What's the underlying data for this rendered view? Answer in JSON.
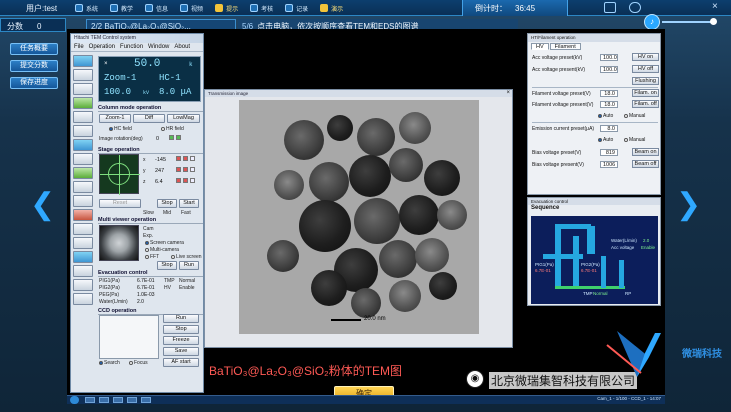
{
  "topbar": {
    "user": "用户:test",
    "nav": [
      {
        "label": "系统",
        "icon": "system-icon"
      },
      {
        "label": "教学",
        "icon": "teaching-icon"
      },
      {
        "label": "信息",
        "icon": "info-icon"
      },
      {
        "label": "视频",
        "icon": "video-icon"
      },
      {
        "label": "提示",
        "icon": "hint-icon",
        "highlight": true
      },
      {
        "label": "考核",
        "icon": "exam-icon"
      },
      {
        "label": "记录",
        "icon": "record-icon"
      },
      {
        "label": "演示",
        "icon": "demo-icon",
        "highlight": true
      }
    ],
    "countdown_label": "倒计时：",
    "countdown_value": "36:45"
  },
  "score": {
    "label": "分数",
    "value": "0"
  },
  "step": {
    "counter": "2/2",
    "title": "BaTiO₃@La₂O₃@SiO₂..."
  },
  "instruction": {
    "counter": "5/6",
    "text": "点击电脑，依次按顺序查看TEM和EDS的图谱"
  },
  "left_menu": [
    "任务概要",
    "提交分数",
    "保存进度"
  ],
  "main_window": {
    "title": "Hitachi TEM Control system",
    "menu": [
      "File",
      "Operation",
      "Function",
      "Window",
      "About"
    ],
    "display": {
      "magnification": "50.0",
      "mag_unit": "k",
      "mode": "Zoom-1",
      "lens": "HC-1",
      "kv": "100.0",
      "kv_unit": "kV",
      "current": "8.0 μA",
      "marker": "×"
    },
    "column_mode": {
      "title": "Column mode operation",
      "buttons": [
        "Zoom-1",
        "Diff",
        "LowMag"
      ],
      "radio": [
        "HC field",
        "HR field"
      ],
      "image_rotation_label": "Image rotation(deg)",
      "image_rotation_value": "0"
    },
    "stage": {
      "title": "Stage operation",
      "x_label": "x",
      "x_value": "-145",
      "y_label": "y",
      "y_value": "247",
      "z_label": "z",
      "z_value": "6.4",
      "buttons": [
        "Reset",
        "Stop",
        "Start"
      ],
      "speed": [
        "Slow",
        "Mid",
        "Fast"
      ]
    },
    "multi_viewer": {
      "title": "Multi viewer operation",
      "cam_label": "Cam",
      "exp_label": "Exp.",
      "options": [
        "Screen camera",
        "Multi-camera",
        "FFT",
        "Live screen"
      ],
      "buttons": [
        "Stop",
        "Run"
      ]
    },
    "evacuation": {
      "title": "Evacuation control",
      "rows": [
        {
          "label": "PIG1(Pa)",
          "value": "6.7E-01",
          "k": "TMP",
          "v": "Normal"
        },
        {
          "label": "PIG2(Pa)",
          "value": "6.7E-01",
          "k": "HV",
          "v": "Enable"
        },
        {
          "label": "PEG(Pa)",
          "value": "1.0E-03",
          "k": "",
          "v": ""
        },
        {
          "label": "Water(L/min)",
          "value": "2.0",
          "k": "",
          "v": ""
        }
      ]
    },
    "ccd": {
      "title": "CCD operation",
      "buttons": [
        "Run",
        "Stop",
        "Freeze",
        "Save",
        "AF start"
      ],
      "radio": [
        "Search",
        "Focus"
      ]
    }
  },
  "tem_window": {
    "title": "Transmission image",
    "scale_label": "20.0 nm"
  },
  "caption": "BaTiO₃@La₂O₃@SiO₂粉体的TEM图",
  "ht_panel": {
    "title": "HT/Filament operation",
    "tabs": [
      "HV",
      "Filament"
    ],
    "acc_set_label": "Acc voltage preset(kV)",
    "acc_set": "100.0",
    "hv_on": "HV on",
    "acc_present_label": "Acc voltage present(kV)",
    "acc_present": "100.0",
    "hv_off": "HV off",
    "flushing": "Flushing",
    "fil_set_label": "Filament voltage preset(V)",
    "fil_set": "18.0",
    "fil_on": "Filam. on",
    "fil_present_label": "Filament voltage present(V)",
    "fil_present": "18.0",
    "fil_off": "Filam. off",
    "fil_mode": [
      "Auto",
      "Manual"
    ],
    "emi_label": "Emission current preset(μA)",
    "emi": "8.0",
    "emi_mode": [
      "Auto",
      "Manual"
    ],
    "bias_set_label": "Bias voltage preset(V)",
    "bias_set": "819",
    "beam_on": "Beam on",
    "bias_present_label": "Bias voltage present(V)",
    "bias_present": "1006",
    "beam_off": "Beam off"
  },
  "sequence": {
    "title": "Evacuation control",
    "header": "Sequence",
    "labels": {
      "water": "Water(L/min)",
      "water_v": "2.0",
      "acc": "Acc voltage",
      "acc_v": "Enable",
      "pig1": "PIG1(Pa)",
      "pig1_v": "6.7E-01",
      "pig2": "PIG2(Pa)",
      "pig2_v": "6.7E-01",
      "tmp": "TMP",
      "tmp_v": "Normal",
      "rp": "RP"
    }
  },
  "ok_button": "确定",
  "taskbar": {
    "clock": "Cam_1 - 1/100 - CCD_1 - 14:07"
  },
  "watermark": "北京微瑞集智科技有限公司",
  "logo_text": "微瑞科技",
  "colors": {
    "accent": "#2fa8ff",
    "caption": "#ff5a55",
    "ok_button": "#f2c43a",
    "display_text": "#8fe3ff"
  }
}
